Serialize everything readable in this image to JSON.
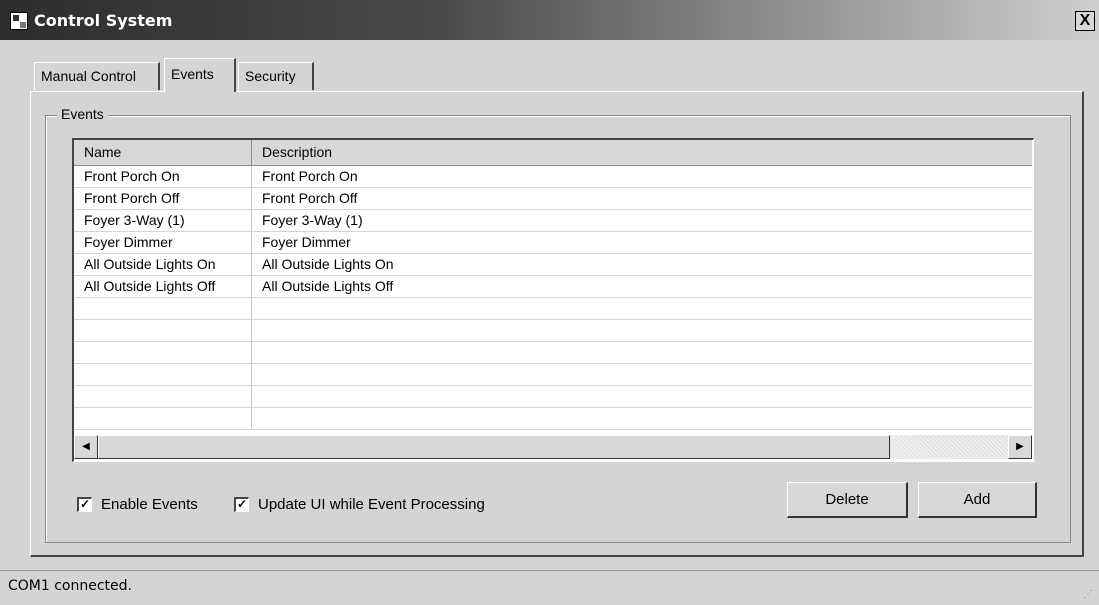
{
  "window": {
    "title": "Control System",
    "close_glyph": "X",
    "icon": "app-icon"
  },
  "tabs": [
    {
      "label": "Manual Control",
      "active": false
    },
    {
      "label": "Events",
      "active": true
    },
    {
      "label": "Security",
      "active": false
    }
  ],
  "events_group": {
    "label": "Events",
    "columns": [
      "Name",
      "Description"
    ],
    "rows": [
      {
        "name": "Front Porch On",
        "description": "Front Porch On"
      },
      {
        "name": "Front Porch Off",
        "description": "Front Porch Off"
      },
      {
        "name": "Foyer 3-Way (1)",
        "description": "Foyer 3-Way (1)"
      },
      {
        "name": "Foyer Dimmer",
        "description": "Foyer Dimmer"
      },
      {
        "name": "All Outside Lights On",
        "description": "All Outside Lights On"
      },
      {
        "name": "All Outside Lights Off",
        "description": "All Outside Lights Off"
      },
      {
        "name": "",
        "description": ""
      },
      {
        "name": "",
        "description": ""
      },
      {
        "name": "",
        "description": ""
      },
      {
        "name": "",
        "description": ""
      },
      {
        "name": "",
        "description": ""
      },
      {
        "name": "",
        "description": ""
      }
    ],
    "scroll_left_glyph": "◀",
    "scroll_right_glyph": "▶"
  },
  "options": {
    "enable_events": {
      "label": "Enable Events",
      "checked": true
    },
    "update_ui": {
      "label": "Update UI while Event Processing",
      "checked": true
    },
    "check_glyph": "✓"
  },
  "buttons": {
    "delete": "Delete",
    "add": "Add"
  },
  "status": {
    "text": "COM1 connected.",
    "grip_glyph": "⋰"
  },
  "colors": {
    "titlebar_dark": "#2d2d2d",
    "face": "#d4d4d4",
    "grid_background": "#ffffff"
  }
}
